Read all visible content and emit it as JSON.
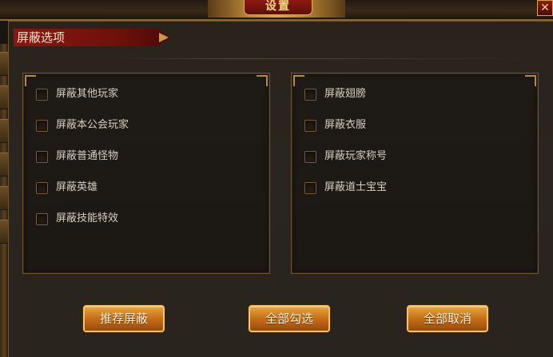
{
  "window": {
    "title": "设置",
    "close_label": "✕"
  },
  "section": {
    "title": "屏蔽选项"
  },
  "options_left": [
    {
      "label": "屏蔽其他玩家",
      "checked": false
    },
    {
      "label": "屏蔽本公会玩家",
      "checked": false
    },
    {
      "label": "屏蔽普通怪物",
      "checked": false
    },
    {
      "label": "屏蔽英雄",
      "checked": false
    },
    {
      "label": "屏蔽技能特效",
      "checked": false
    }
  ],
  "options_right": [
    {
      "label": "屏蔽翅膀",
      "checked": false
    },
    {
      "label": "屏蔽衣服",
      "checked": false
    },
    {
      "label": "屏蔽玩家称号",
      "checked": false
    },
    {
      "label": "屏蔽道士宝宝",
      "checked": false
    }
  ],
  "buttons": {
    "recommend_label": "推荐屏蔽",
    "select_all_label": "全部勾选",
    "cancel_all_label": "全部取消"
  },
  "colors": {
    "accent_gold": "#f2c56a",
    "header_red": "#8a1710",
    "button_orange": "#c46e18"
  }
}
